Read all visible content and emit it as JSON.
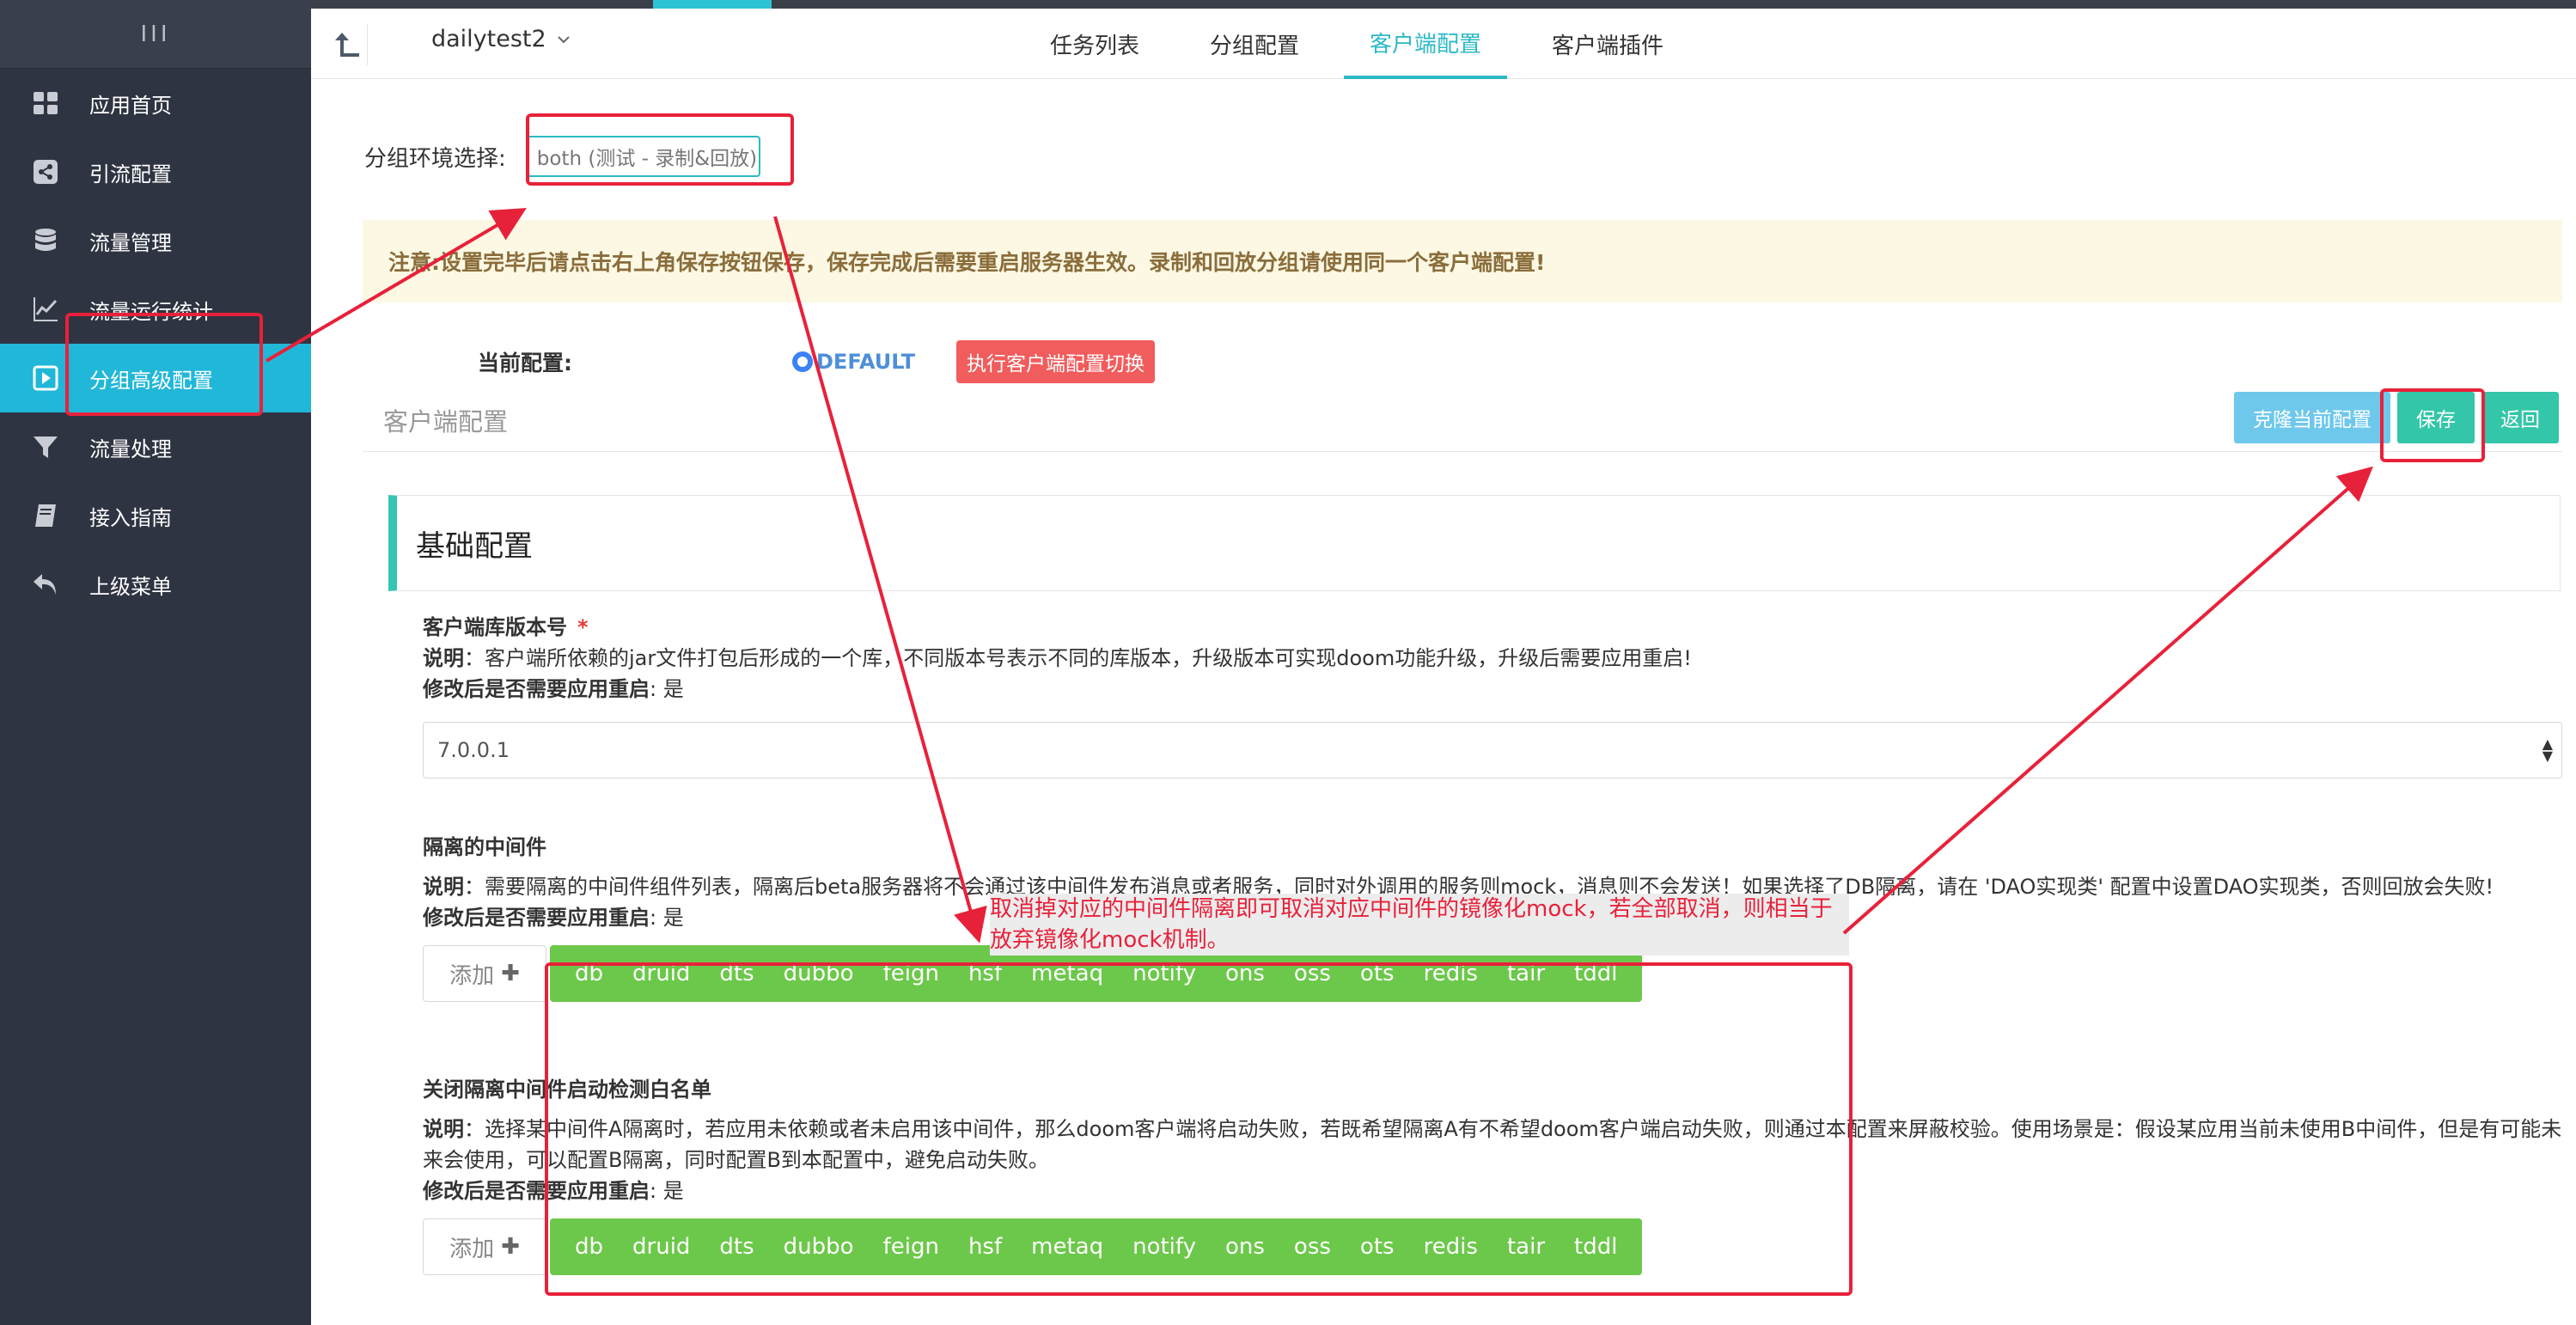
{
  "sidebar": {
    "toggle_label": "III",
    "items": [
      {
        "label": "应用首页",
        "icon": "grid-icon"
      },
      {
        "label": "引流配置",
        "icon": "share-icon"
      },
      {
        "label": "流量管理",
        "icon": "database-icon"
      },
      {
        "label": "流量运行统计",
        "icon": "chart-line-icon"
      },
      {
        "label": "分组高级配置",
        "icon": "play-square-icon",
        "active": true
      },
      {
        "label": "流量处理",
        "icon": "filter-icon"
      },
      {
        "label": "接入指南",
        "icon": "book-icon"
      },
      {
        "label": "上级菜单",
        "icon": "undo-icon"
      }
    ]
  },
  "topbar": {
    "app_name": "dailytest2",
    "tabs": [
      "任务列表",
      "分组配置",
      "客户端配置",
      "客户端插件"
    ],
    "active_tab": "客户端配置"
  },
  "env": {
    "label": "分组环境选择:",
    "value": "both (测试 - 录制&回放)"
  },
  "notice": "注意:设置完毕后请点击右上角保存按钮保存，保存完成后需要重启服务器生效。录制和回放分组请使用同一个客户端配置!",
  "current": {
    "label": "当前配置:",
    "option": "DEFAULT",
    "switch_label": "执行客户端配置切换"
  },
  "section": {
    "title": "客户端配置",
    "clone_label": "克隆当前配置",
    "save_label": "保存",
    "back_label": "返回"
  },
  "card_title": "基础配置",
  "fields": {
    "version": {
      "title": "客户端库版本号",
      "required_mark": "*",
      "desc_prefix": "说明",
      "desc": "：客户端所依赖的jar文件打包后形成的一个库，不同版本号表示不同的库版本，升级版本可实现doom功能升级，升级后需要应用重启!",
      "restart_label": "修改后是否需要应用重启",
      "restart_value": ": 是",
      "value": "7.0.0.1"
    },
    "isolation": {
      "title": "隔离的中间件",
      "desc_prefix": "说明",
      "desc": "：需要隔离的中间件组件列表，隔离后beta服务器将不会通过该中间件发布消息或者服务，同时对外调用的服务则mock，消息则不会发送！如果选择了DB隔离，请在 'DAO实现类' 配置中设置DAO实现类，否则回放会失败!",
      "restart_label": "修改后是否需要应用重启",
      "restart_value": ": 是",
      "add_label": "添加",
      "tags": [
        "db",
        "druid",
        "dts",
        "dubbo",
        "feign",
        "hsf",
        "metaq",
        "notify",
        "ons",
        "oss",
        "ots",
        "redis",
        "tair",
        "tddl"
      ]
    },
    "whitelist": {
      "title": "关闭隔离中间件启动检测白名单",
      "desc_prefix": "说明",
      "desc": "：选择某中间件A隔离时，若应用未依赖或者未启用该中间件，那么doom客户端将启动失败，若既希望隔离A有不希望doom客户端启动失败，则通过本配置来屏蔽校验。使用场景是：假设某应用当前未使用B中间件，但是有可能未来会使用，可以配置B隔离，同时配置B到本配置中，避免启动失败。",
      "restart_label": "修改后是否需要应用重启",
      "restart_value": ": 是",
      "add_label": "添加",
      "tags": [
        "db",
        "druid",
        "dts",
        "dubbo",
        "feign",
        "hsf",
        "metaq",
        "notify",
        "ons",
        "oss",
        "ots",
        "redis",
        "tair",
        "tddl"
      ]
    }
  },
  "annotation": "取消掉对应的中间件隔离即可取消对应中间件的镜像化mock，若全部取消，则相当于放弃镜像化mock机制。",
  "colors": {
    "sidebar_bg": "#2f3442",
    "sidebar_active": "#21b7d9",
    "accent": "#2cb9c7",
    "tag_green": "#6cc84a",
    "annotation_red": "#e8213a",
    "notice_bg": "#fcf8e3"
  }
}
